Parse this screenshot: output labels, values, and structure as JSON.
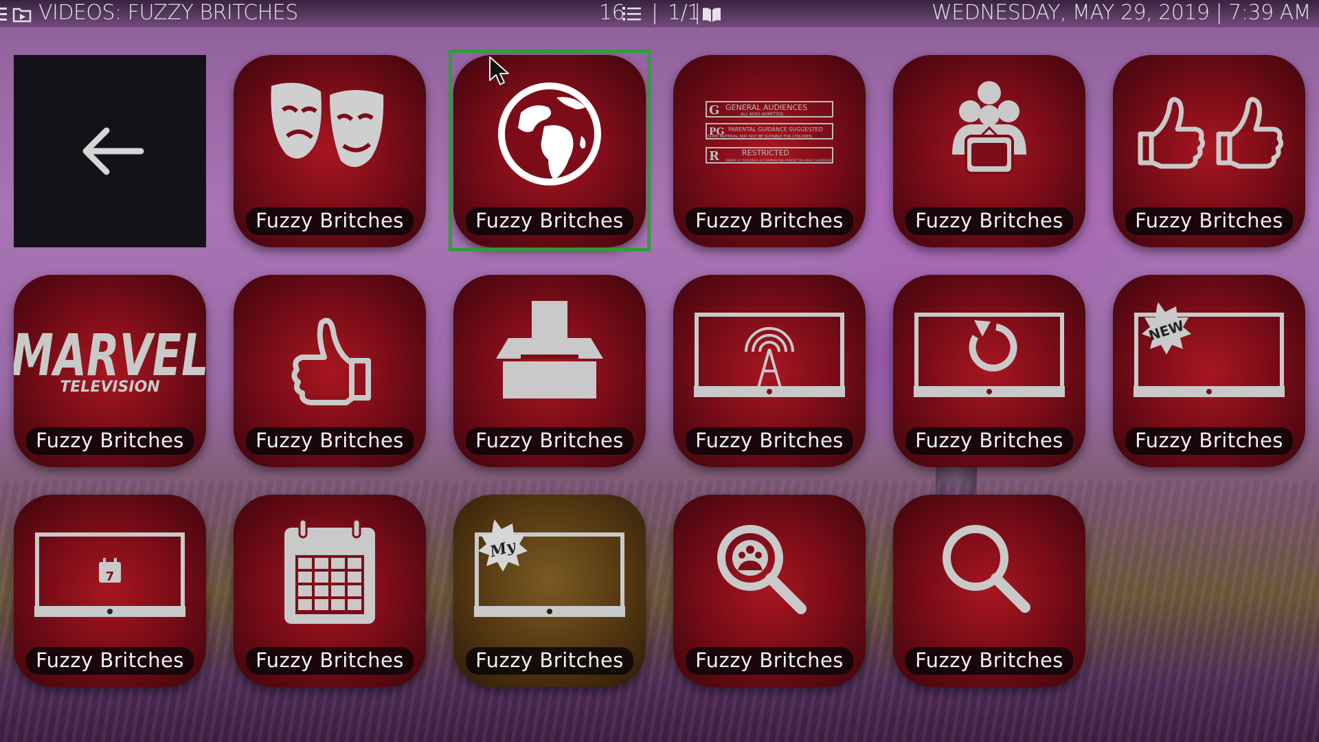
{
  "header": {
    "title": "VIDEOS: FUZZY BRITCHES",
    "count": "16",
    "page": "1/1",
    "datetime": "WEDNESDAY, MAY 29, 2019 | 7:39 AM"
  },
  "colors": {
    "focus_border": "#2e9e3a",
    "tile_red": "#8c0f1a",
    "tile_gold": "#6a4a1a"
  },
  "tiles": [
    {
      "icon": "back-arrow-icon",
      "label": ""
    },
    {
      "icon": "theater-masks-icon",
      "label": "Fuzzy Britches"
    },
    {
      "icon": "globe-icon",
      "label": "Fuzzy Britches",
      "focused": true
    },
    {
      "icon": "movie-ratings-icon",
      "label": "Fuzzy Britches"
    },
    {
      "icon": "family-tv-icon",
      "label": "Fuzzy Britches"
    },
    {
      "icon": "two-thumbs-up-icon",
      "label": "Fuzzy Britches"
    },
    {
      "icon": "marvel-television-logo",
      "label": "Fuzzy Britches"
    },
    {
      "icon": "thumb-up-icon",
      "label": "Fuzzy Britches"
    },
    {
      "icon": "ballot-box-icon",
      "label": "Fuzzy Britches"
    },
    {
      "icon": "tv-broadcast-icon",
      "label": "Fuzzy Britches"
    },
    {
      "icon": "tv-refresh-icon",
      "label": "Fuzzy Britches"
    },
    {
      "icon": "tv-new-icon",
      "label": "Fuzzy Britches"
    },
    {
      "icon": "tv-calendar-icon",
      "label": "Fuzzy Britches"
    },
    {
      "icon": "calendar-icon",
      "label": "Fuzzy Britches"
    },
    {
      "icon": "tv-my-icon",
      "label": "Fuzzy Britches"
    },
    {
      "icon": "search-people-icon",
      "label": "Fuzzy Britches"
    },
    {
      "icon": "search-icon",
      "label": "Fuzzy Britches"
    }
  ],
  "art_text": {
    "ratings": [
      "GENERAL AUDIENCES",
      "ALL AGES ADMITTED",
      "PARENTAL GUIDANCE SUGGESTED",
      "SOME MATERIAL MAY NOT BE SUITABLE FOR CHILDREN",
      "RESTRICTED",
      "UNDER 17 REQUIRES ACCOMPANYING PARENT OR ADULT GUARDIAN"
    ],
    "marvel_top": "MARVEL",
    "marvel_bottom": "TELEVISION",
    "badge_new": "NEW",
    "badge_my": "My",
    "calendar_day": "7"
  }
}
